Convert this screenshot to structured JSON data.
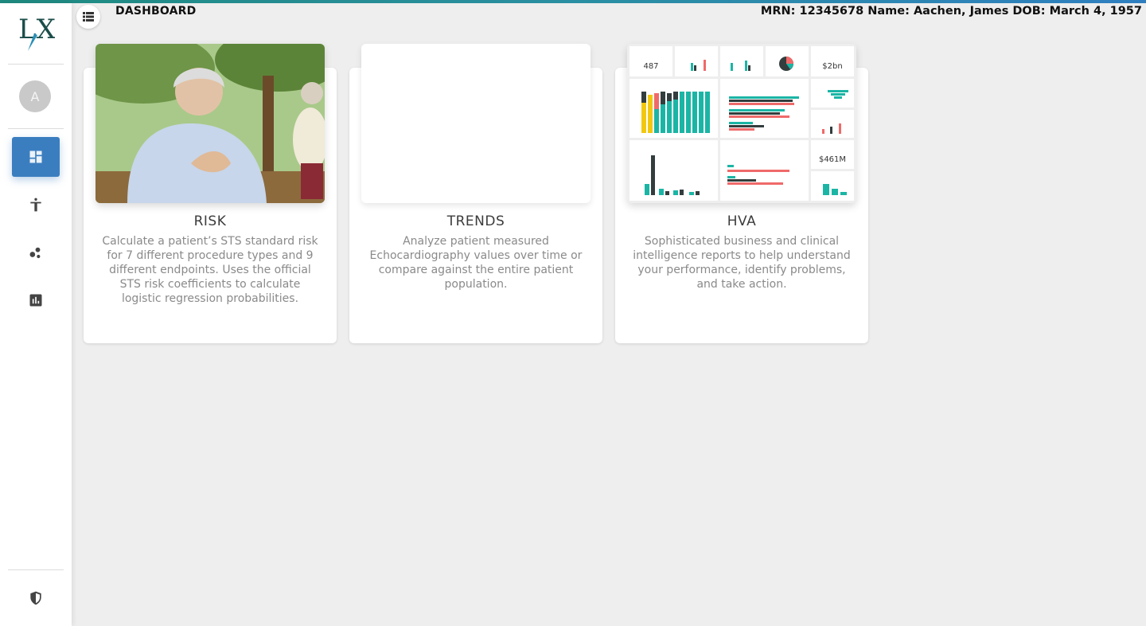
{
  "header": {
    "title": "DASHBOARD",
    "patient_info": "MRN: 12345678 Name: Aachen, James DOB: March 4, 1957"
  },
  "sidebar": {
    "logo": "LX",
    "avatar_initial": "A",
    "items": [
      {
        "name": "dashboard",
        "icon": "dashboard-icon",
        "active": true
      },
      {
        "name": "patient",
        "icon": "accessibility-icon",
        "active": false
      },
      {
        "name": "scatter",
        "icon": "bubble-chart-icon",
        "active": false
      },
      {
        "name": "reports",
        "icon": "bar-chart-icon",
        "active": false
      }
    ],
    "bottom_icon": "shield-icon"
  },
  "cards": [
    {
      "title": "RISK",
      "description": "Calculate a patient’s STS standard risk for 7 different procedure types and 9 different endpoints. Uses the official STS risk coefficients to calculate logistic regression probabilities."
    },
    {
      "title": "TRENDS",
      "description": "Analyze patient measured Echocardiography values over time or compare against the entire patient population."
    },
    {
      "title": "HVA",
      "description": "Sophisticated business and clinical intelligence reports to help understand your performance, identify problems, and take action.",
      "thumb": {
        "opportunity_count": "487",
        "revenue": "$2bn",
        "won_revenue": "$461M"
      }
    }
  ],
  "colors": {
    "accent": "#3b7ec0",
    "teal": "#1bb5a5",
    "dark": "#333d3d",
    "coral": "#f06a6a",
    "yellow": "#f2c80f"
  }
}
